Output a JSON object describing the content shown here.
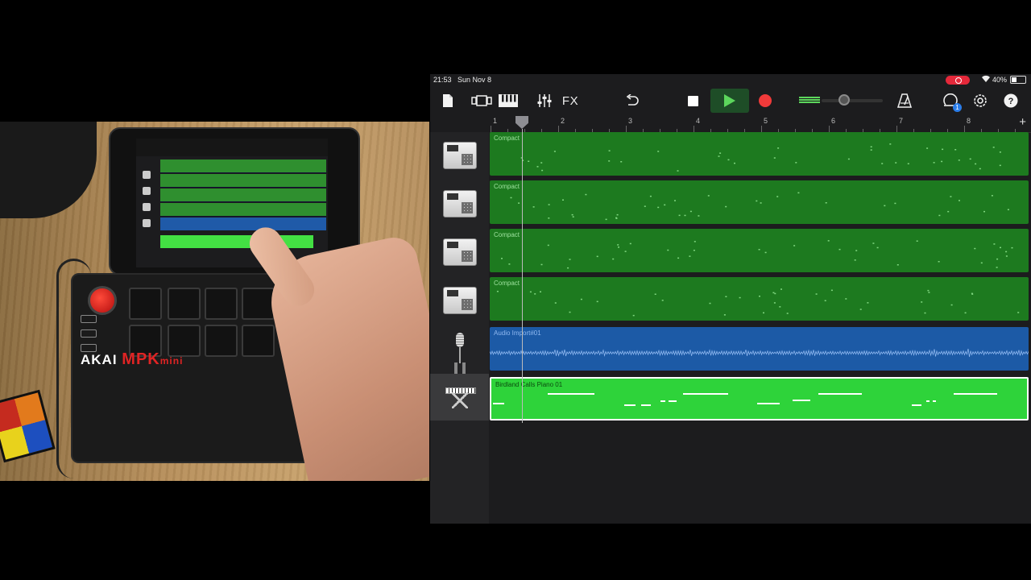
{
  "status_bar": {
    "time": "21:53",
    "date": "Sun Nov 8",
    "battery": "40%"
  },
  "toolbar": {
    "fx_label": "FX",
    "icons": [
      "document-icon",
      "track-view-icon",
      "keyboard-icon",
      "mixer-icon",
      "undo-icon",
      "stop-icon",
      "play-icon",
      "record-icon",
      "metronome-icon",
      "loop-browser-icon",
      "settings-icon",
      "help-icon"
    ],
    "notification_count": "1"
  },
  "ruler": {
    "bars": [
      "1",
      "2",
      "3",
      "4",
      "5",
      "6",
      "7",
      "8"
    ],
    "add_label": "+"
  },
  "tracks": [
    {
      "type": "drum",
      "region_name": "Compact"
    },
    {
      "type": "drum",
      "region_name": "Compact"
    },
    {
      "type": "drum",
      "region_name": "Compact"
    },
    {
      "type": "drum",
      "region_name": "Compact"
    },
    {
      "type": "audio",
      "region_name": "Audio Import#01"
    },
    {
      "type": "keys",
      "region_name": "Birdland Calls Piano 01"
    }
  ],
  "add_track_label": "+",
  "photo": {
    "brand": "AKAI",
    "model": "MPK",
    "model_suffix": "mini"
  },
  "colors": {
    "drum_region": "#1d7a1f",
    "audio_region": "#1c5aa6",
    "keys_region": "#2ed33a",
    "record": "#f03a3a",
    "play": "#5cd65c"
  }
}
